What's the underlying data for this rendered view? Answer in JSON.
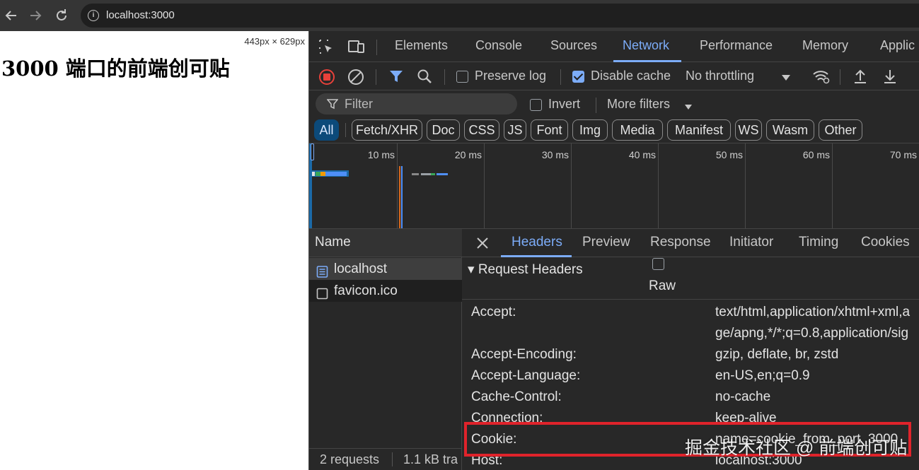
{
  "browser": {
    "url": "localhost:3000",
    "back_icon": "back-arrow-icon",
    "forward_icon": "forward-arrow-icon",
    "reload_icon": "reload-icon",
    "info_icon": "site-info-icon"
  },
  "page": {
    "dimensions": "443px × 629px",
    "heading": "3000 端口的前端创可贴"
  },
  "devtools": {
    "tabs": [
      "Elements",
      "Console",
      "Sources",
      "Network",
      "Performance",
      "Memory",
      "Applic"
    ],
    "active_tab": "Network",
    "toolbar": {
      "preserve_log": "Preserve log",
      "preserve_log_checked": false,
      "disable_cache": "Disable cache",
      "disable_cache_checked": true,
      "throttling": "No throttling"
    },
    "filter": {
      "placeholder": "Filter",
      "invert": "Invert",
      "more_filters": "More filters"
    },
    "type_filters": [
      "All",
      "Fetch/XHR",
      "Doc",
      "CSS",
      "JS",
      "Font",
      "Img",
      "Media",
      "Manifest",
      "WS",
      "Wasm",
      "Other"
    ],
    "active_type": "All",
    "timeline_ticks": [
      "10 ms",
      "20 ms",
      "30 ms",
      "40 ms",
      "50 ms",
      "60 ms",
      "70 ms"
    ],
    "requests_header": "Name",
    "requests": [
      {
        "name": "localhost",
        "selected": true
      },
      {
        "name": "favicon.ico",
        "selected": false
      }
    ],
    "status": {
      "requests": "2 requests",
      "transferred": "1.1 kB tra"
    },
    "detail_tabs": [
      "Headers",
      "Preview",
      "Response",
      "Initiator",
      "Timing",
      "Cookies"
    ],
    "active_detail_tab": "Headers",
    "section_title": "▾ Request Headers",
    "raw_label": "Raw",
    "headers": [
      {
        "name": "Accept:",
        "value": "text/html,application/xhtml+xml,a",
        "value2": "ge/apng,*/*;q=0.8,application/sig"
      },
      {
        "name": "Accept-Encoding:",
        "value": "gzip, deflate, br, zstd"
      },
      {
        "name": "Accept-Language:",
        "value": "en-US,en;q=0.9"
      },
      {
        "name": "Cache-Control:",
        "value": "no-cache"
      },
      {
        "name": "Connection:",
        "value": "keep-alive"
      },
      {
        "name": "Cookie:",
        "value": "name=cookie_from_port_3000"
      },
      {
        "name": "Host:",
        "value": "localhost:3000"
      }
    ]
  },
  "watermark": "掘金技术社区 @ 前端创可贴",
  "colors": {
    "accent": "#7cacf8",
    "highlight": "#e0232b",
    "active_filter_bg": "#0c4a7a"
  }
}
